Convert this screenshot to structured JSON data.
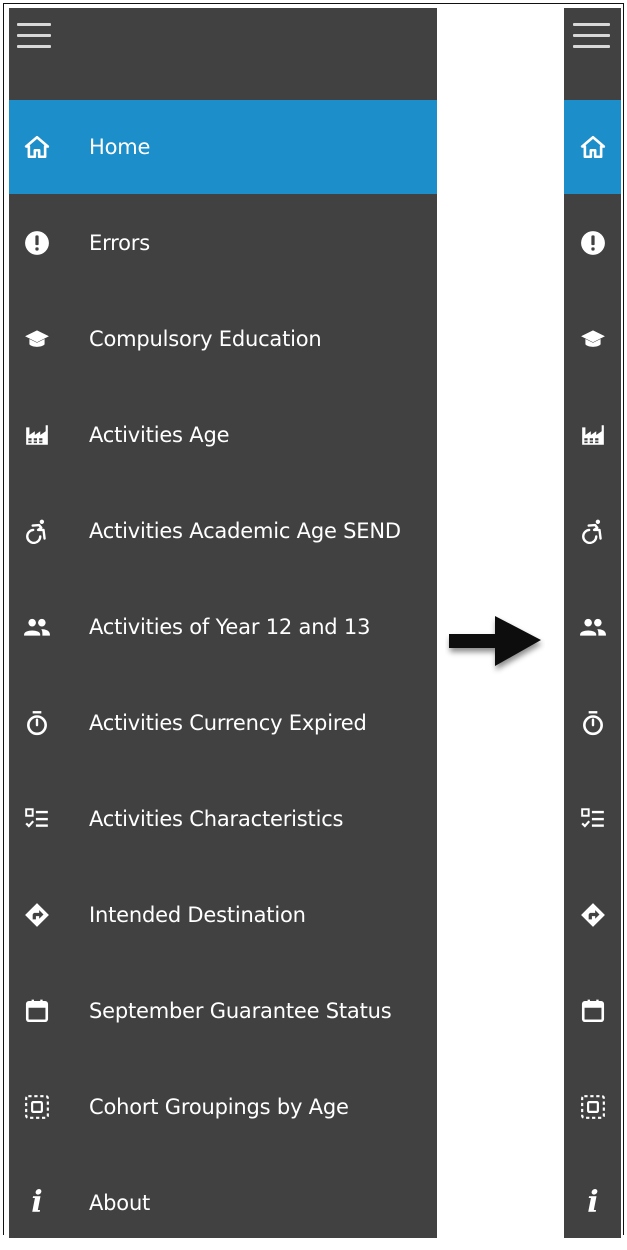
{
  "menu": {
    "items": [
      {
        "label": "Home",
        "icon": "home-icon",
        "active": true
      },
      {
        "label": "Errors",
        "icon": "exclamation-icon"
      },
      {
        "label": "Compulsory Education",
        "icon": "graduation-cap-icon"
      },
      {
        "label": "Activities Age",
        "icon": "factory-icon"
      },
      {
        "label": "Activities Academic Age SEND",
        "icon": "accessibility-icon"
      },
      {
        "label": "Activities of Year 12 and 13",
        "icon": "people-icon"
      },
      {
        "label": "Activities Currency Expired",
        "icon": "stopwatch-icon"
      },
      {
        "label": "Activities Characteristics",
        "icon": "checklist-icon"
      },
      {
        "label": "Intended Destination",
        "icon": "directions-icon"
      },
      {
        "label": "September Guarantee Status",
        "icon": "calendar-icon"
      },
      {
        "label": "Cohort Groupings by Age",
        "icon": "group-select-icon"
      },
      {
        "label": "About",
        "icon": "info-icon"
      }
    ]
  },
  "colors": {
    "panel_bg": "#414141",
    "active_bg": "#1c8ec9",
    "text": "#ffffff"
  }
}
